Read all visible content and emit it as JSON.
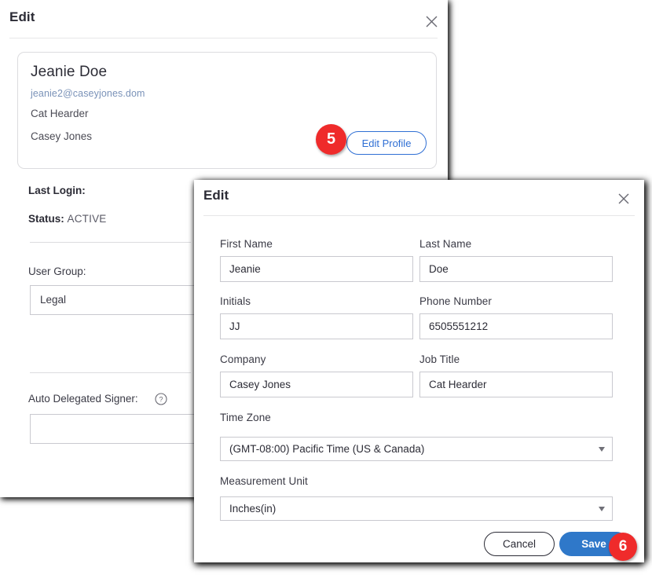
{
  "back_dialog": {
    "title": "Edit",
    "close_icon": "close-icon",
    "profile": {
      "name": "Jeanie Doe",
      "email": "jeanie2@caseyjones.dom",
      "job_title": "Cat Hearder",
      "company": "Casey Jones",
      "edit_profile_button": "Edit Profile"
    },
    "details": {
      "last_login_label": "Last Login:",
      "last_login_value": "",
      "status_label": "Status:",
      "status_value": "ACTIVE",
      "user_group_label": "User Group:",
      "user_group_value": "Legal",
      "auto_delegated_signer_label": "Auto Delegated Signer:",
      "auto_delegated_signer_value": "",
      "help_icon": "help-circle-icon"
    }
  },
  "front_dialog": {
    "title": "Edit",
    "close_icon": "close-icon",
    "fields": {
      "first_name_label": "First Name",
      "first_name_value": "Jeanie",
      "last_name_label": "Last Name",
      "last_name_value": "Doe",
      "initials_label": "Initials",
      "initials_value": "JJ",
      "phone_label": "Phone Number",
      "phone_value": "6505551212",
      "company_label": "Company",
      "company_value": "Casey Jones",
      "job_title_label": "Job Title",
      "job_title_value": "Cat Hearder",
      "time_zone_label": "Time Zone",
      "time_zone_value": "(GMT-08:00) Pacific Time (US & Canada)",
      "measurement_unit_label": "Measurement Unit",
      "measurement_unit_value": "Inches(in)"
    },
    "footer": {
      "cancel_label": "Cancel",
      "save_label": "Save"
    }
  },
  "annotations": {
    "step5": "5",
    "step6": "6"
  },
  "colors": {
    "badge_red": "#ef2b2b",
    "primary_blue": "#2f78c9",
    "link_blue": "#2f6fd4",
    "email_blue": "#7a92b8"
  }
}
